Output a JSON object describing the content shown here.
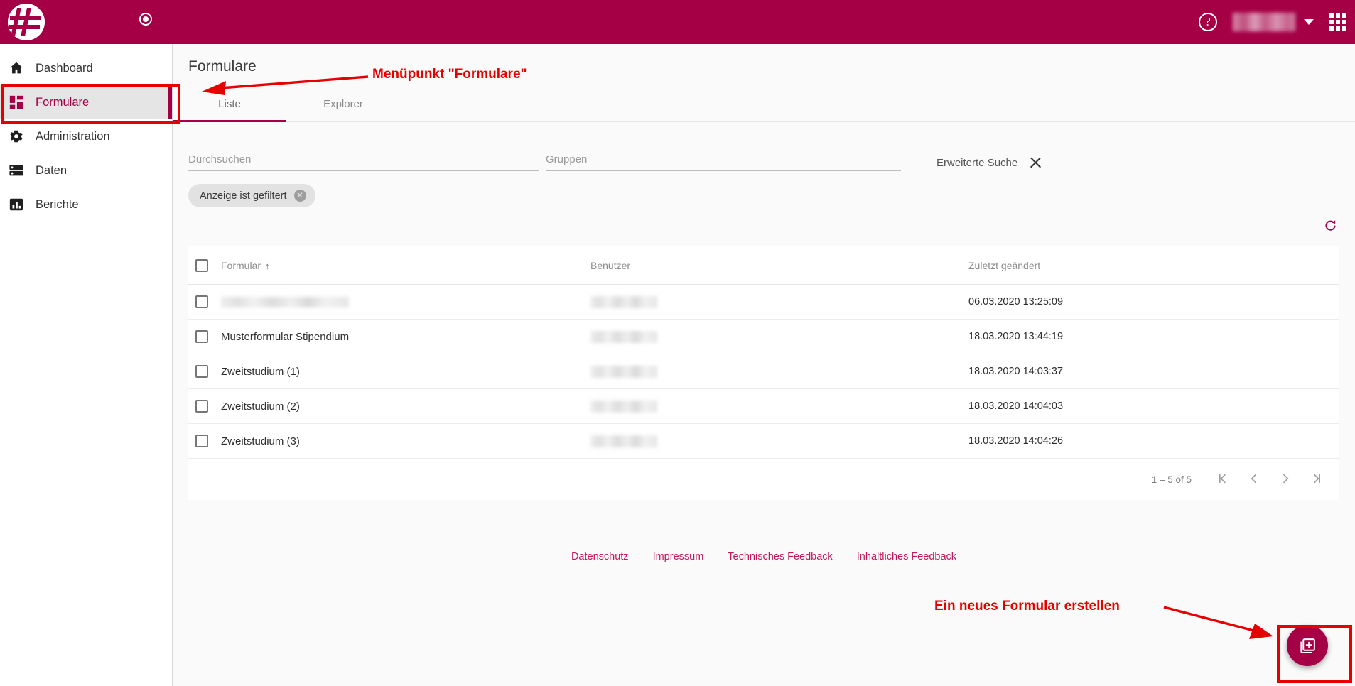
{
  "header": {
    "logo_icon": "hash-logo-icon",
    "record_icon": "record-circle-icon",
    "help_icon": "help-circle-icon",
    "help_label": "?",
    "user_name": "",
    "chevron_icon": "chevron-down-icon",
    "apps_icon": "apps-grid-icon",
    "brand_color": "#A50046"
  },
  "sidebar": {
    "items": [
      {
        "label": "Dashboard",
        "icon": "home-icon",
        "active": false
      },
      {
        "label": "Formulare",
        "icon": "dashboard-icon",
        "active": true
      },
      {
        "label": "Administration",
        "icon": "gear-icon",
        "active": false
      },
      {
        "label": "Daten",
        "icon": "storage-icon",
        "active": false
      },
      {
        "label": "Berichte",
        "icon": "bar-chart-icon",
        "active": false
      }
    ]
  },
  "main": {
    "page_title": "Formulare",
    "tabs": [
      {
        "label": "Liste",
        "active": true
      },
      {
        "label": "Explorer",
        "active": false
      }
    ],
    "search": {
      "value": "",
      "placeholder": "Durchsuchen"
    },
    "groups": {
      "value": "",
      "placeholder": "Gruppen"
    },
    "advanced_search": {
      "label": "Erweiterte Suche",
      "close_icon": "close-icon"
    },
    "filter_chip": {
      "label": "Anzeige ist gefiltert",
      "remove_icon": "chip-remove-icon",
      "remove_label": "✕"
    },
    "refresh_icon": "refresh-icon",
    "table": {
      "columns": [
        {
          "key": "formular",
          "label": "Formular",
          "sorted": true,
          "sort_dir": "↑"
        },
        {
          "key": "benutzer",
          "label": "Benutzer",
          "sorted": false,
          "sort_dir": ""
        },
        {
          "key": "geaendert",
          "label": "Zuletzt geändert",
          "sorted": false,
          "sort_dir": ""
        }
      ],
      "rows": [
        {
          "formular": "",
          "formular_blurred": true,
          "benutzer": "",
          "benutzer_blurred": true,
          "geaendert": "06.03.2020 13:25:09"
        },
        {
          "formular": "Musterformular Stipendium",
          "formular_blurred": false,
          "benutzer": "",
          "benutzer_blurred": true,
          "geaendert": "18.03.2020 13:44:19"
        },
        {
          "formular": "Zweitstudium (1)",
          "formular_blurred": false,
          "benutzer": "",
          "benutzer_blurred": true,
          "geaendert": "18.03.2020 14:03:37"
        },
        {
          "formular": "Zweitstudium (2)",
          "formular_blurred": false,
          "benutzer": "",
          "benutzer_blurred": true,
          "geaendert": "18.03.2020 14:04:03"
        },
        {
          "formular": "Zweitstudium (3)",
          "formular_blurred": false,
          "benutzer": "",
          "benutzer_blurred": true,
          "geaendert": "18.03.2020 14:04:26"
        }
      ]
    },
    "paginator": {
      "range_label": "1 – 5 of 5",
      "first_icon": "first-page-icon",
      "prev_icon": "previous-page-icon",
      "next_icon": "next-page-icon",
      "last_icon": "last-page-icon"
    },
    "footer_links": [
      {
        "label": "Datenschutz"
      },
      {
        "label": "Impressum"
      },
      {
        "label": "Technisches Feedback"
      },
      {
        "label": "Inhaltliches Feedback"
      }
    ],
    "fab": {
      "icon": "library-add-icon",
      "title": "Ein neues Formular erstellen"
    }
  },
  "annotations": {
    "color": "#E60000",
    "menu_note": "Menüpunkt \"Formulare\"",
    "fab_note": "Ein neues Formular erstellen"
  }
}
